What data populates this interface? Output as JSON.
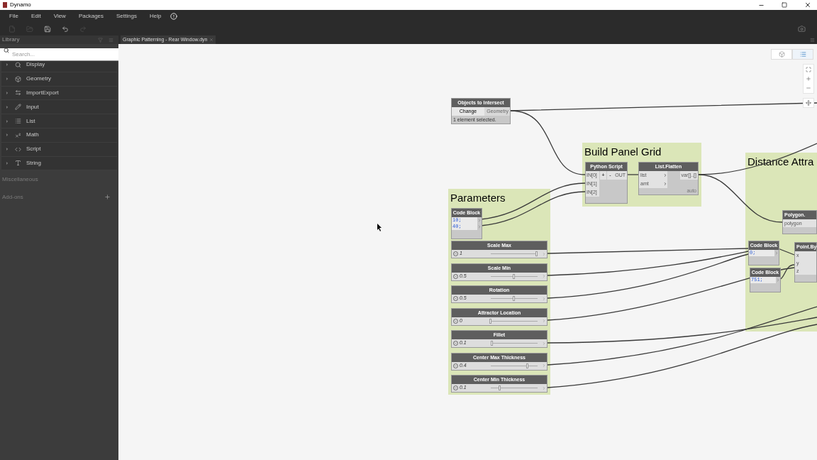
{
  "window": {
    "title": "Dynamo"
  },
  "menu": [
    "File",
    "Edit",
    "View",
    "Packages",
    "Settings",
    "Help"
  ],
  "toolbar": [
    {
      "disabled": true
    },
    {
      "disabled": true
    },
    {
      "disabled": false
    },
    {
      "disabled": false
    },
    {
      "disabled": true
    }
  ],
  "library": {
    "title": "Library",
    "search": {
      "placeholder": "Search..."
    },
    "categories": [
      "Display",
      "Geometry",
      "ImportExport",
      "Input",
      "List",
      "Math",
      "Script",
      "String"
    ],
    "sections": [
      "Miscellaneous",
      "Add-ons"
    ]
  },
  "tabs": [
    {
      "label": "Graphic Patterning - Rear Window.dyn",
      "selected": true
    }
  ],
  "groups": [
    {
      "title": "Build Panel Grid"
    },
    {
      "title": "Parameters"
    },
    {
      "title": "Distance Attra"
    }
  ],
  "select_node": {
    "title": "Objects to Intersect",
    "button": "Change",
    "output": "Geometry",
    "status": "1 element selected."
  },
  "python_node": {
    "title": "Python Script",
    "inputs": [
      "IN[0]",
      "IN[1]",
      "IN[2]"
    ],
    "add": "+",
    "remove": "-",
    "output": "OUT"
  },
  "flatten_node": {
    "title": "List.Flatten",
    "inputs": [
      "list",
      "amt"
    ],
    "output": "var[]..[]",
    "lacing": "auto"
  },
  "code_blocks": [
    {
      "title": "Code Block",
      "lines": [
        "10;",
        "40;"
      ]
    },
    {
      "title": "Code Block",
      "lines": [
        "0;"
      ]
    },
    {
      "title": "Code Block",
      "lines": [
        "751;"
      ]
    }
  ],
  "sliders": [
    {
      "title": "Scale Max",
      "value": "1",
      "level": 0.97
    },
    {
      "title": "Scale Min",
      "value": "0.5",
      "level": 0.5
    },
    {
      "title": "Rotation",
      "value": "0.5",
      "level": 0.5
    },
    {
      "title": "Attractor Location",
      "value": "0",
      "level": 0.0
    },
    {
      "title": "Fillet",
      "value": "0.1",
      "level": 0.03
    },
    {
      "title": "Center Max Thickness",
      "value": "0.4",
      "level": 0.78
    },
    {
      "title": "Center Min Thickness",
      "value": "0.1",
      "level": 0.2
    }
  ],
  "polygon_node": {
    "title": "Polygon.",
    "inputs": [
      "polygon"
    ]
  },
  "point_node": {
    "title": "Point.By",
    "inputs": [
      "x",
      "y",
      "z"
    ]
  }
}
